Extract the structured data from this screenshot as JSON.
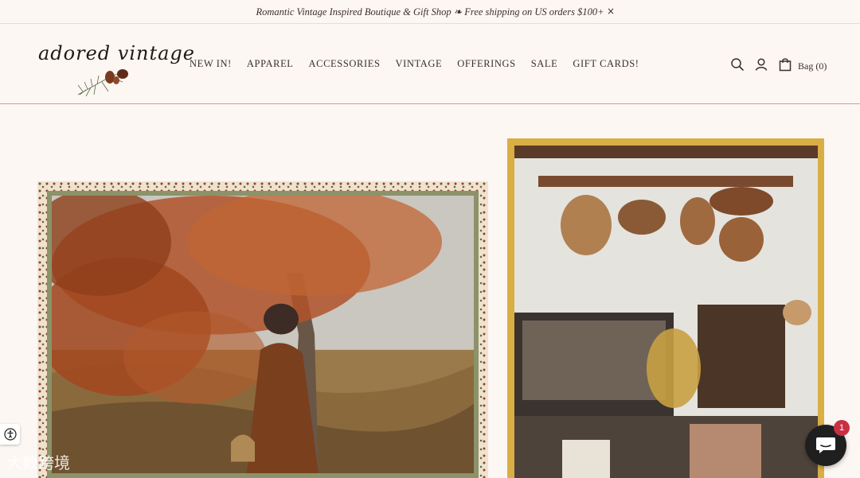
{
  "announcement": {
    "text": "Romantic Vintage Inspired Boutique & Gift Shop ❧ Free shipping on US orders $100+",
    "close_label": "×"
  },
  "logo": {
    "text": "adored vintage"
  },
  "nav": {
    "items": [
      {
        "label": "NEW IN!"
      },
      {
        "label": "APPAREL"
      },
      {
        "label": "ACCESSORIES"
      },
      {
        "label": "VINTAGE"
      },
      {
        "label": "OFFERINGS"
      },
      {
        "label": "SALE"
      },
      {
        "label": "GIFT CARDS!"
      }
    ]
  },
  "tools": {
    "search_icon": "search-icon",
    "account_icon": "account-icon",
    "bag_icon": "shopping-bag-icon",
    "bag_label": "Bag (0)"
  },
  "chat": {
    "badge_count": "1",
    "icon": "chat-bubble-icon"
  },
  "accessibility": {
    "icon": "accessibility-icon"
  },
  "watermark": {
    "text": "大数跨境"
  },
  "colors": {
    "background": "#fcf7f3",
    "header_rule": "#cf9f88",
    "right_frame": "#d9ae45",
    "left_inner_frame": "#8c926a",
    "chat_badge": "#c73043"
  }
}
